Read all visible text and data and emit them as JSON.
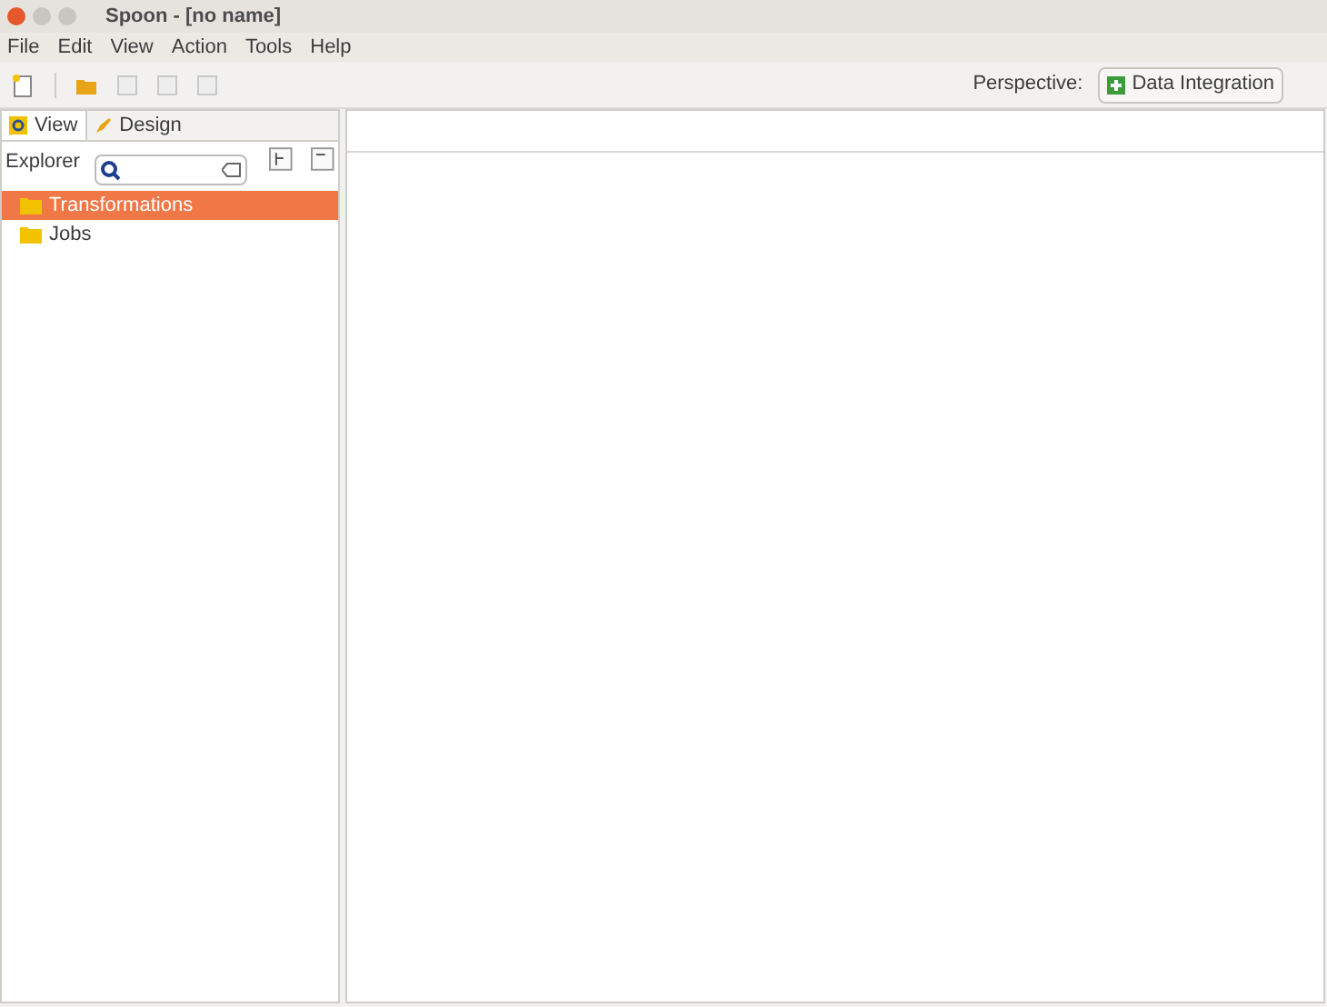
{
  "window": {
    "title": "Spoon - [no name]"
  },
  "menu": [
    "File",
    "Edit",
    "View",
    "Action",
    "Tools",
    "Help"
  ],
  "toolbar": [
    {
      "kind": "new",
      "disabled": false
    },
    {
      "kind": "open",
      "disabled": false
    },
    {
      "kind": "explore",
      "disabled": true
    },
    {
      "kind": "save",
      "disabled": true
    },
    {
      "kind": "saveas",
      "disabled": true
    }
  ],
  "perspective": {
    "label": "Perspective:",
    "button": "Data Integration"
  },
  "tabs": [
    {
      "label": "View",
      "selected": true
    },
    {
      "label": "Design",
      "selected": false
    }
  ],
  "explorer": {
    "label": "Explorer"
  },
  "tree": [
    {
      "label": "Transformations",
      "selected": true
    },
    {
      "label": "Jobs",
      "selected": false
    }
  ]
}
